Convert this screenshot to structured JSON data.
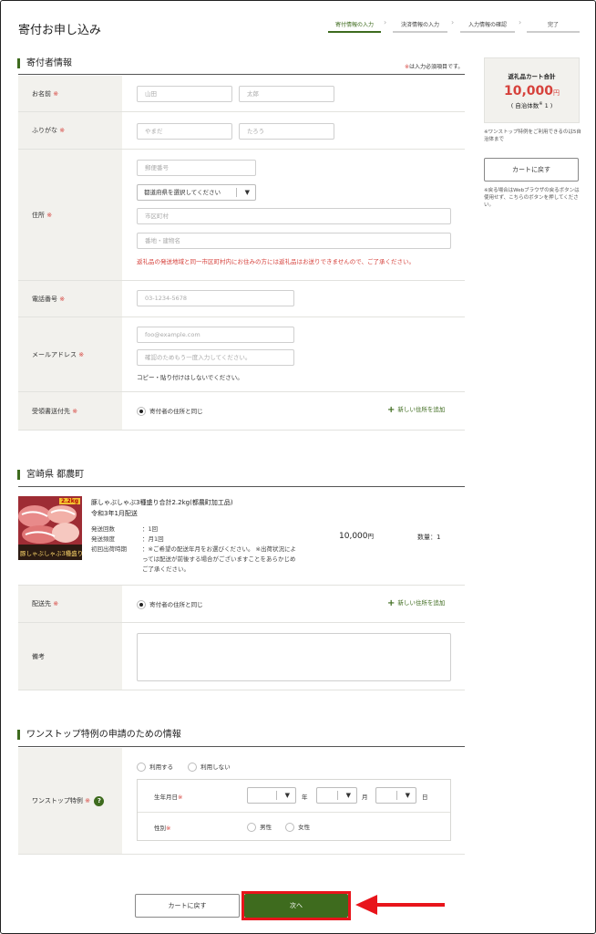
{
  "page": {
    "title": "寄付お申し込み"
  },
  "steps": [
    "寄付情報の入力",
    "決済情報の入力",
    "入力情報の確認",
    "完了"
  ],
  "donor": {
    "title": "寄付者情報",
    "required_note": "は入力必須項目です。",
    "required_mark": "※",
    "name": {
      "label": "お名前",
      "last_placeholder": "山田",
      "first_placeholder": "太郎"
    },
    "kana": {
      "label": "ふりがな",
      "last_placeholder": "やまだ",
      "first_placeholder": "たろう"
    },
    "address": {
      "label": "住所",
      "postal_placeholder": "郵便番号",
      "pref_select": "都道府県を選択してください",
      "city_placeholder": "市区町村",
      "street_placeholder": "番地・建物名",
      "warning": "返礼品の発送地域と同一市区町村内にお住みの方には返礼品はお送りできませんので、ご了承ください。"
    },
    "phone": {
      "label": "電話番号",
      "placeholder": "03-1234-5678"
    },
    "email": {
      "label": "メールアドレス",
      "placeholder": "foo@example.com",
      "confirm_placeholder": "確認のためもう一度入力してください。",
      "note": "コピー・貼り付けはしないでください。"
    },
    "receipt": {
      "label": "受領書送付先",
      "option": "寄付者の住所と同じ",
      "add_link": "新しい住所を追加"
    }
  },
  "sidebar": {
    "total_label": "返礼品カート合計",
    "total_amount": "10,000",
    "total_unit": "円",
    "count_prefix": "( 自治体数",
    "count_mark": "※",
    "count_value": " 1 )",
    "note1": "※ワンストップ特例をご利用できるのは5自治体まで",
    "cart_button": "カートに戻す",
    "note2": "※戻る場合はWebブラウザの戻るボタンは使用せず、こちらのボタンを押してください。"
  },
  "municipality": {
    "title": "宮崎県 都農町",
    "product": {
      "image_badge": "2.2kg",
      "image_caption": "豚しゃぶしゃぶ3種盛り",
      "name": "豚しゃぶしゃぶ3種盛り合計2.2kg(都農町加工品)",
      "sub": "令和3年1月配送",
      "details": [
        {
          "key": "発送回数",
          "value": "：1回"
        },
        {
          "key": "発送頻度",
          "value": "：月1回"
        },
        {
          "key": "初回出荷時期",
          "value": "：※ご希望の配送年月をお選びください。 ※出荷状況によっては配送が前後する場合がございますことをあらかじめご了承ください。"
        }
      ],
      "price": "10,000",
      "price_unit": "円",
      "quantity": "数量：1"
    },
    "delivery": {
      "label": "配送先",
      "option": "寄付者の住所と同じ",
      "add_link": "新しい住所を追加"
    },
    "remarks": {
      "label": "備考"
    }
  },
  "onestop": {
    "title": "ワンストップ特例の申請のための情報",
    "label": "ワンストップ特例",
    "help": "?",
    "use": "利用する",
    "not_use": "利用しない",
    "birth_label": "生年月日",
    "year": "年",
    "month": "月",
    "day": "日",
    "gender_label": "性別",
    "male": "男性",
    "female": "女性"
  },
  "footer": {
    "back_button": "カートに戻す",
    "next_button": "次へ"
  },
  "colors": {
    "accent": "#3e6b1e",
    "required": "#d6423c",
    "highlight": "#e8141b"
  }
}
